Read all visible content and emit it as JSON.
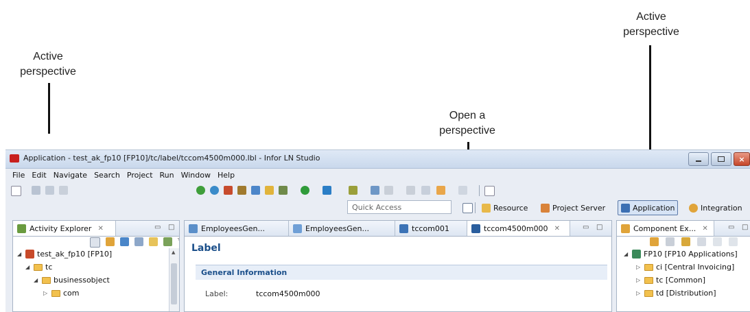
{
  "annotations": {
    "left": [
      "Active",
      "perspective"
    ],
    "middle": [
      "Open a",
      "perspective"
    ],
    "right": [
      "Active",
      "perspective"
    ]
  },
  "window": {
    "title": "Application - test_ak_fp10 [FP10]/tc/label/tccom4500m000.lbl - Infor LN Studio",
    "menu": [
      "File",
      "Edit",
      "Navigate",
      "Search",
      "Project",
      "Run",
      "Window",
      "Help"
    ]
  },
  "quick_access": {
    "placeholder": "Quick Access"
  },
  "perspectives": {
    "resource": "Resource",
    "project_server": "Project Server",
    "application": "Application",
    "integration": "Integration"
  },
  "activity_explorer": {
    "tab_label": "Activity Explorer",
    "tree": [
      "test_ak_fp10 [FP10]",
      "tc",
      "businessobject",
      "com"
    ]
  },
  "editor": {
    "tabs": [
      "EmployeesGen...",
      "EmployeesGen...",
      "tccom001",
      "tccom4500m000"
    ],
    "heading": "Label",
    "section_title": "General Information",
    "fields": [
      {
        "label": "Label:",
        "value": "tccom4500m000"
      }
    ]
  },
  "component_explorer": {
    "tab_label": "Component Ex...",
    "tree": [
      "FP10 [FP10 Applications]",
      "ci [Central Invoicing]",
      "tc [Common]",
      "td [Distribution]"
    ]
  },
  "colors": {
    "title_red": "#c8201e",
    "tree_blue": "#1b4f8a",
    "active_blue": "#d6e3f5"
  }
}
